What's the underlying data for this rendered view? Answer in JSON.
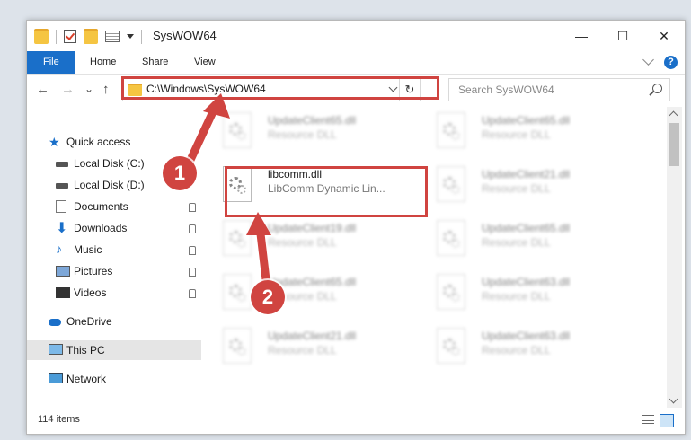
{
  "window": {
    "title": "SysWOW64"
  },
  "window_controls": {
    "minimize": "—",
    "maximize": "☐",
    "close": "✕"
  },
  "ribbon": {
    "tabs": [
      "File",
      "Home",
      "Share",
      "View"
    ],
    "help": "?"
  },
  "nav": {
    "back": "←",
    "forward": "→",
    "recent": "⌄",
    "up": "↑",
    "refresh": "↻"
  },
  "address": {
    "path": "C:\\Windows\\SysWOW64"
  },
  "search": {
    "placeholder": "Search SysWOW64"
  },
  "sidebar": {
    "items": [
      {
        "label": "Quick access",
        "icon": "star-icon",
        "pinned": false
      },
      {
        "label": "Local Disk (C:)",
        "icon": "drive-icon",
        "pinned": false
      },
      {
        "label": "Local Disk (D:)",
        "icon": "drive-icon",
        "pinned": false
      },
      {
        "label": "Documents",
        "icon": "documents-icon",
        "pinned": true
      },
      {
        "label": "Downloads",
        "icon": "download-icon",
        "pinned": true
      },
      {
        "label": "Music",
        "icon": "music-icon",
        "pinned": true
      },
      {
        "label": "Pictures",
        "icon": "pictures-icon",
        "pinned": true
      },
      {
        "label": "Videos",
        "icon": "videos-icon",
        "pinned": true
      },
      {
        "label": "OneDrive",
        "icon": "onedrive-icon",
        "pinned": false
      },
      {
        "label": "This PC",
        "icon": "pc-icon",
        "pinned": false,
        "selected": true
      },
      {
        "label": "Network",
        "icon": "network-icon",
        "pinned": false
      }
    ]
  },
  "files": [
    {
      "name": "UpdateClient65.dll",
      "desc": "Resource DLL",
      "blurred": true
    },
    {
      "name": "UpdateClient65.dll",
      "desc": "Resource DLL",
      "blurred": true
    },
    {
      "name": "libcomm.dll",
      "desc": "LibComm Dynamic Lin...",
      "blurred": false
    },
    {
      "name": "UpdateClient21.dll",
      "desc": "Resource DLL",
      "blurred": true
    },
    {
      "name": "UpdateClient19.dll",
      "desc": "Resource DLL",
      "blurred": true
    },
    {
      "name": "UpdateClient65.dll",
      "desc": "Resource DLL",
      "blurred": true
    },
    {
      "name": "UpdateClient65.dll",
      "desc": "Resource DLL",
      "blurred": true
    },
    {
      "name": "UpdateClient63.dll",
      "desc": "Resource DLL",
      "blurred": true
    },
    {
      "name": "UpdateClient21.dll",
      "desc": "Resource DLL",
      "blurred": true
    },
    {
      "name": "UpdateClient63.dll",
      "desc": "Resource DLL",
      "blurred": true
    }
  ],
  "status": {
    "count": "114 items"
  },
  "annotations": {
    "marker1": "1",
    "marker2": "2",
    "color": "#d04440"
  },
  "colors": {
    "accent": "#1a6fc9",
    "highlight": "#d04440"
  }
}
